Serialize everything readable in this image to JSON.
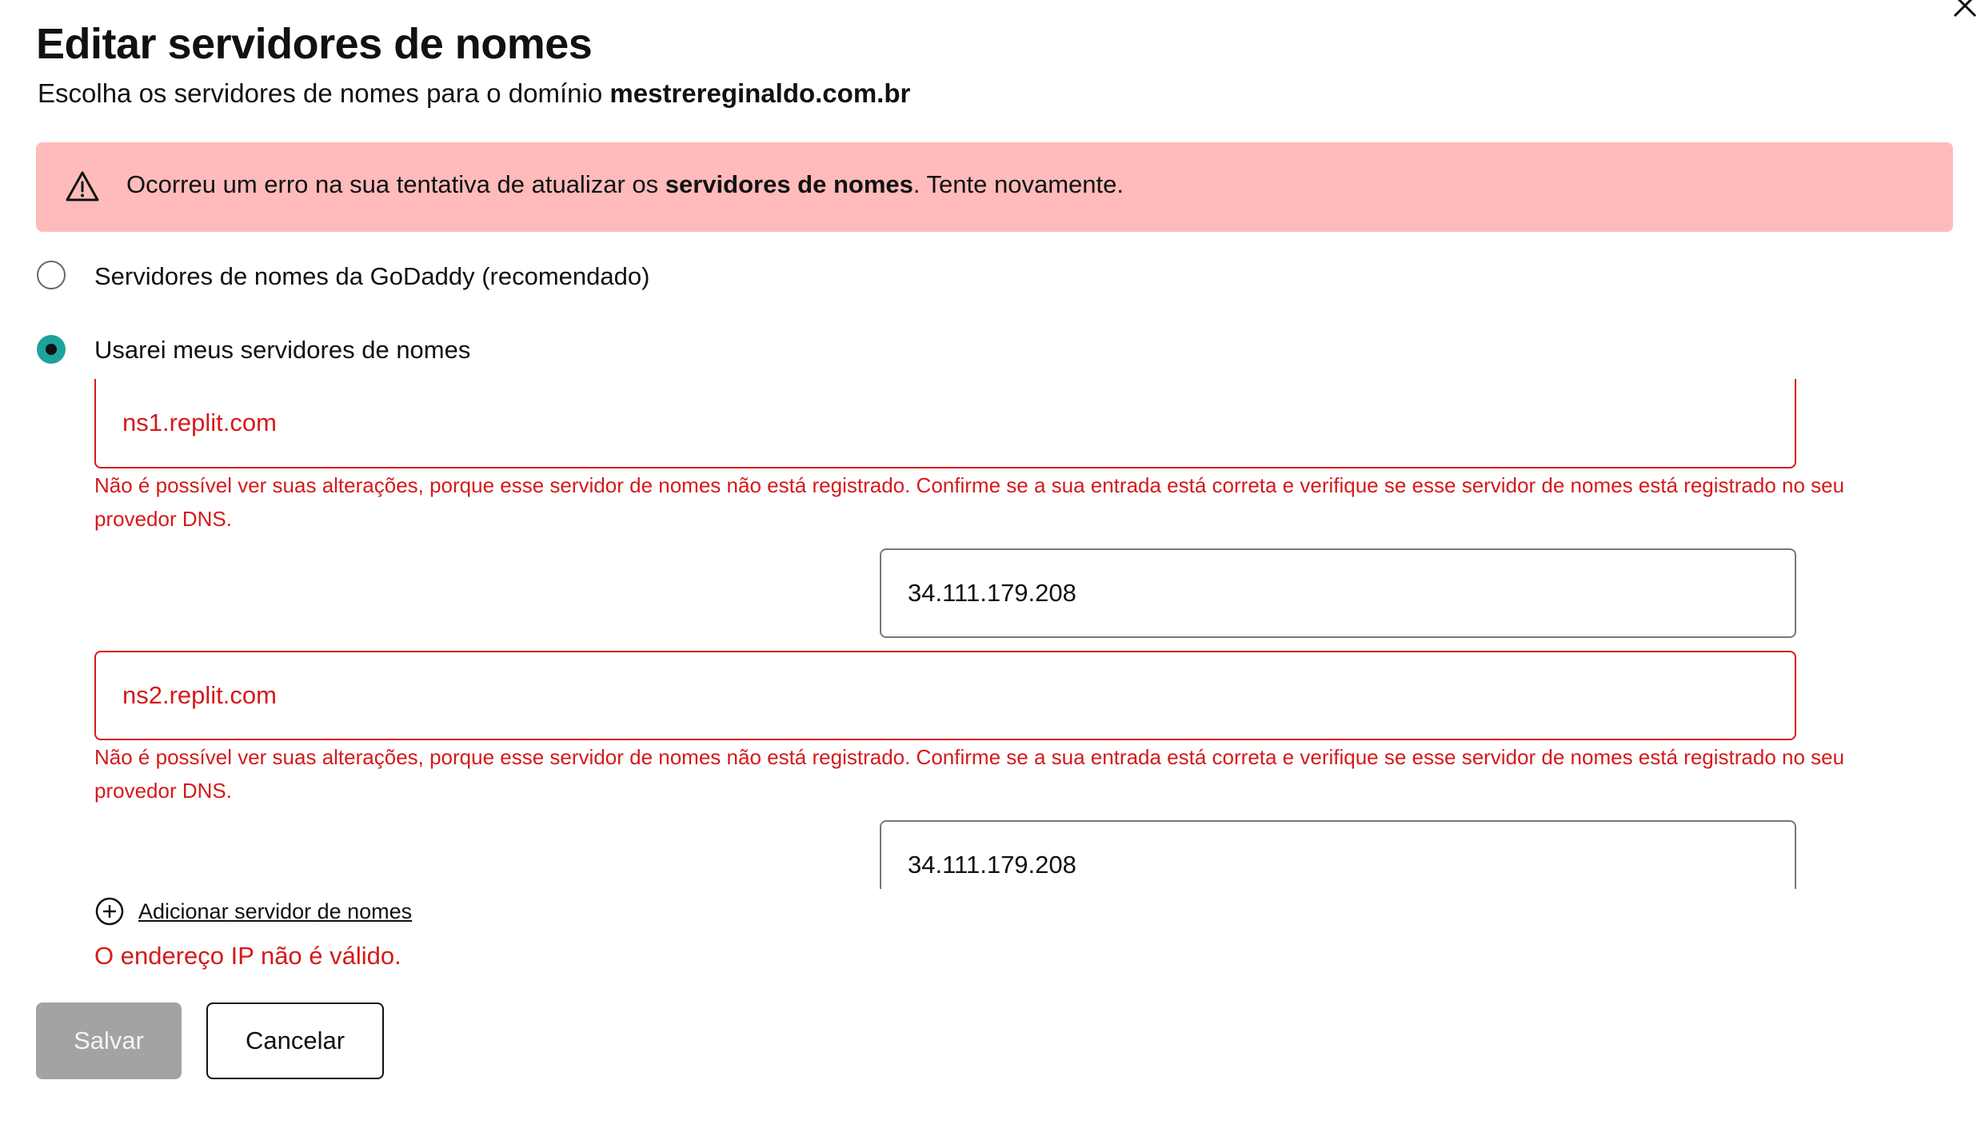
{
  "dialog": {
    "title": "Editar servidores de nomes",
    "subtitle_prefix": "Escolha os servidores de nomes para o domínio ",
    "domain": "mestrereginaldo.com.br"
  },
  "alert": {
    "icon": "warning-triangle-icon",
    "text_before": "Ocorreu um erro na sua tentativa de atualizar os ",
    "text_bold": "servidores de nomes",
    "text_after": ". Tente novamente.",
    "background": "#ffbbbb"
  },
  "options": {
    "godaddy_label": "Servidores de nomes da GoDaddy (recomendado)",
    "custom_label": "Usarei meus servidores de nomes",
    "selected": "custom",
    "accent_color": "#1ba39c"
  },
  "nameservers": [
    {
      "host": "ns1.replit.com",
      "error": "Não é possível ver suas alterações, porque esse servidor de nomes não está registrado. Confirme se a sua entrada está correta e verifique se esse servidor de nomes está registrado no seu provedor DNS.",
      "ip": "34.111.179.208"
    },
    {
      "host": "ns2.replit.com",
      "error": "Não é possível ver suas alterações, porque esse servidor de nomes não está registrado. Confirme se a sua entrada está correta e verifique se esse servidor de nomes está registrado no seu provedor DNS.",
      "ip": "34.111.179.208"
    }
  ],
  "add_nameserver_label": "Adicionar servidor de nomes",
  "ip_error": "O endereço IP não é válido.",
  "buttons": {
    "save": "Salvar",
    "cancel": "Cancelar"
  },
  "colors": {
    "error": "#d51a1a",
    "disabled_button": "#a3a3a3"
  }
}
